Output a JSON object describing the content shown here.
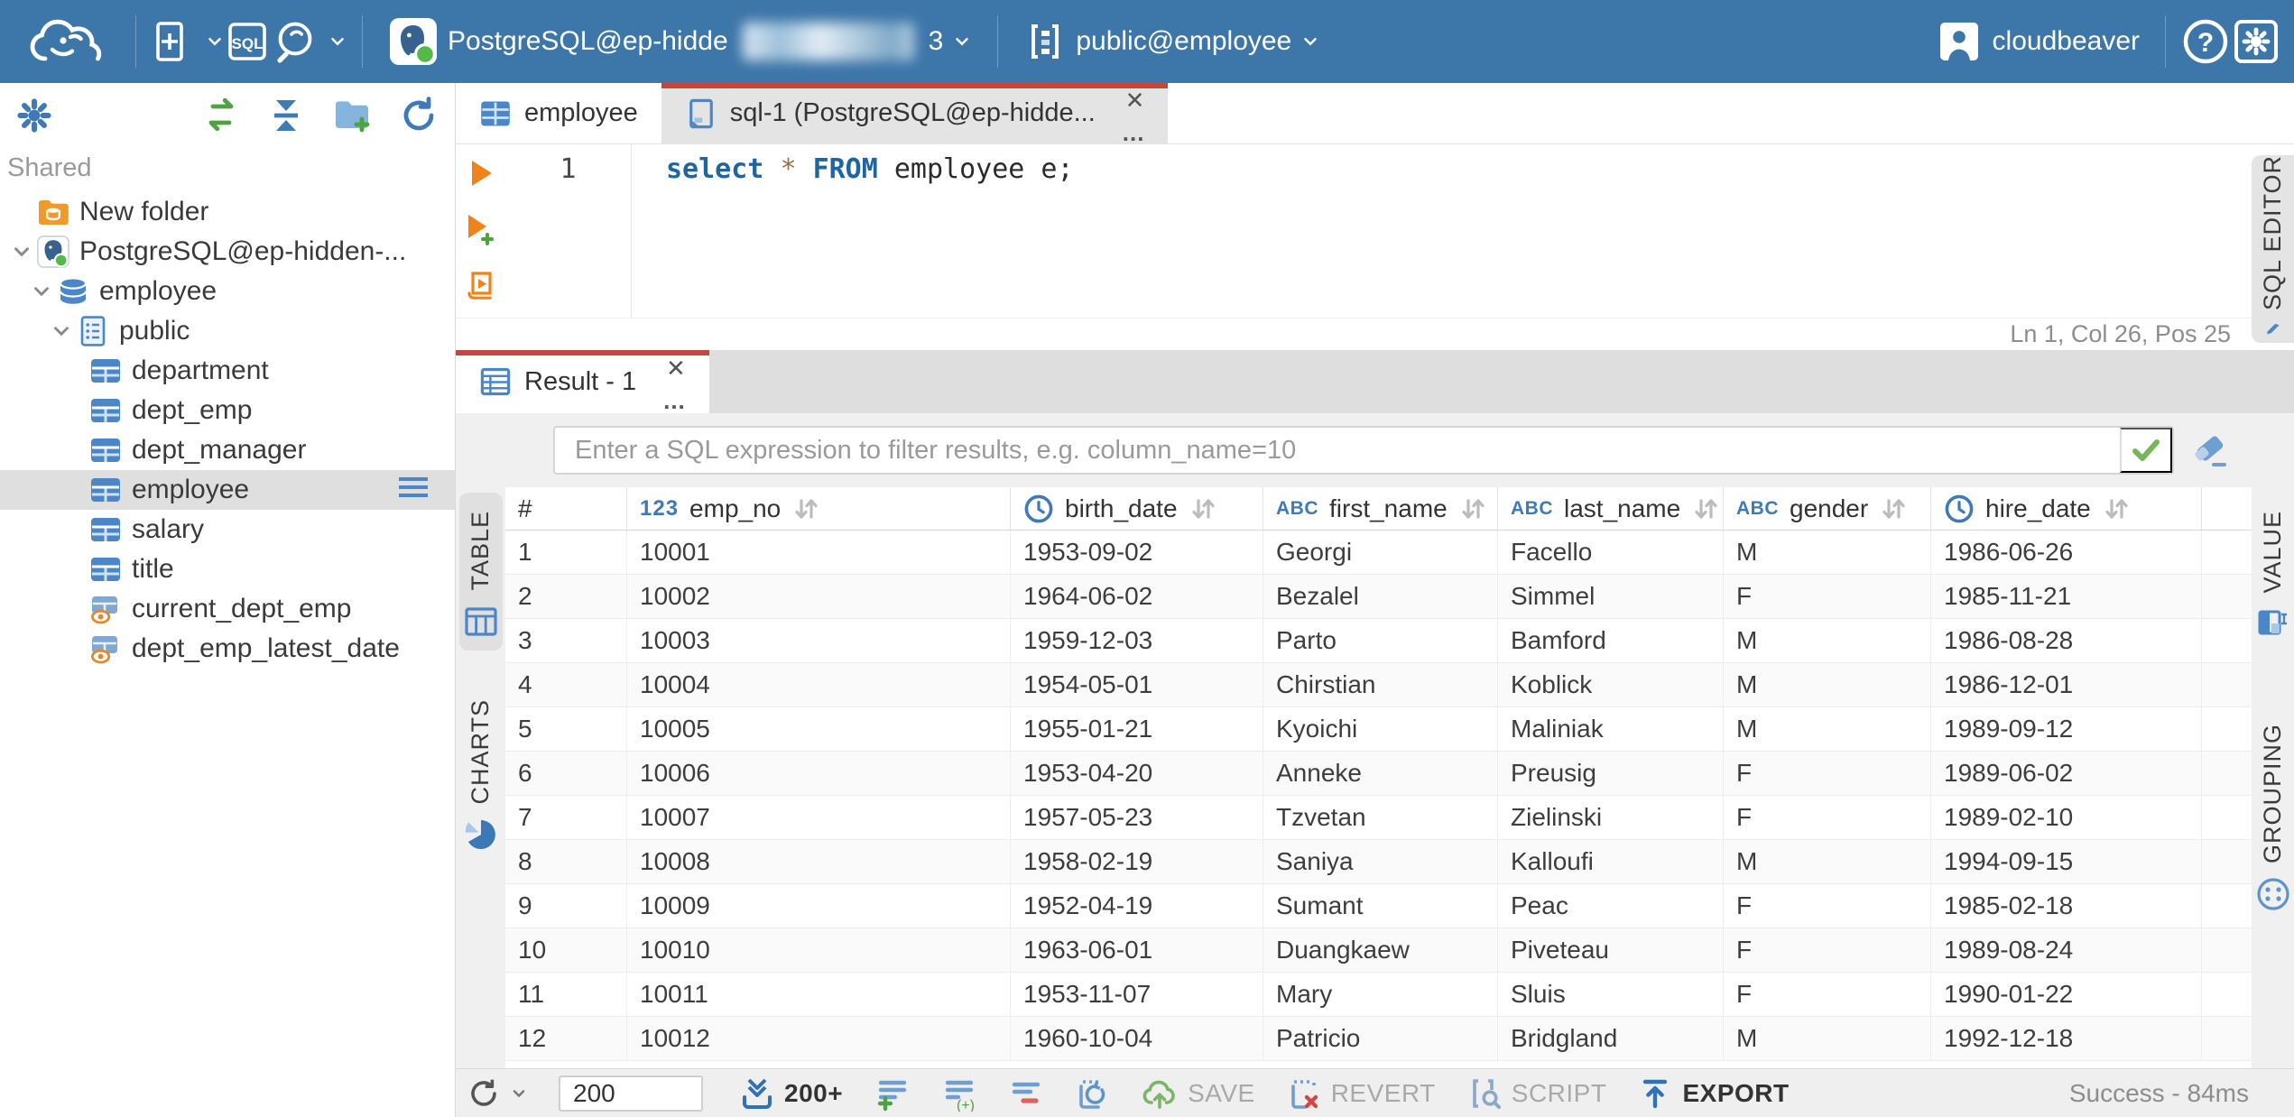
{
  "topbar": {
    "sql_badge": "SQL",
    "connection": {
      "label_visible": "PostgreSQL@ep-hidde",
      "label_suffix": "3",
      "redacted": true
    },
    "schema": "public@employee",
    "user": "cloudbeaver"
  },
  "sidebar": {
    "section_label": "Shared",
    "tree": [
      {
        "label": "New folder",
        "icon": "folder-db",
        "level": 1,
        "chevron": false
      },
      {
        "label": "PostgreSQL@ep-hidden-...",
        "icon": "postgres",
        "level": 1,
        "chevron": true
      },
      {
        "label": "employee",
        "icon": "database",
        "level": 2,
        "chevron": true
      },
      {
        "label": "public",
        "icon": "schema",
        "level": 3,
        "chevron": true
      },
      {
        "label": "department",
        "icon": "table",
        "level": 4,
        "chevron": false
      },
      {
        "label": "dept_emp",
        "icon": "table",
        "level": 4,
        "chevron": false
      },
      {
        "label": "dept_manager",
        "icon": "table",
        "level": 4,
        "chevron": false
      },
      {
        "label": "employee",
        "icon": "table",
        "level": 4,
        "chevron": false,
        "selected": true
      },
      {
        "label": "salary",
        "icon": "table",
        "level": 4,
        "chevron": false
      },
      {
        "label": "title",
        "icon": "table",
        "level": 4,
        "chevron": false
      },
      {
        "label": "current_dept_emp",
        "icon": "view",
        "level": 4,
        "chevron": false
      },
      {
        "label": "dept_emp_latest_date",
        "icon": "view",
        "level": 4,
        "chevron": false
      }
    ]
  },
  "tabs": [
    {
      "label": "employee",
      "active": false
    },
    {
      "label": "sql-1 (PostgreSQL@ep-hidde...",
      "active": true
    }
  ],
  "editor": {
    "line_number": "1",
    "sql": "select * FROM employee e;",
    "tokens": [
      {
        "text": "select",
        "style": "kw"
      },
      {
        "text": " ",
        "style": ""
      },
      {
        "text": "*",
        "style": "star"
      },
      {
        "text": " ",
        "style": ""
      },
      {
        "text": "FROM",
        "style": "kw"
      },
      {
        "text": " employee e;",
        "style": ""
      }
    ],
    "status": "Ln 1, Col 26, Pos 25",
    "panel_tab": "SQL EDITOR"
  },
  "result": {
    "tab_label": "Result - 1",
    "filter_placeholder": "Enter a SQL expression to filter results, e.g. column_name=10",
    "side_tabs_left": [
      {
        "label": "TABLE",
        "icon": "grid-icon",
        "active": true
      },
      {
        "label": "CHARTS",
        "icon": "pie-icon",
        "active": false
      }
    ],
    "side_tabs_right": [
      {
        "label": "VALUE",
        "icon": "value-icon",
        "active": false
      },
      {
        "label": "GROUPING",
        "icon": "grouping-icon",
        "active": false
      }
    ],
    "grid": {
      "columns": [
        {
          "label": "#",
          "type": "",
          "sortable": false
        },
        {
          "label": "emp_no",
          "type": "123",
          "sortable": true
        },
        {
          "label": "birth_date",
          "type": "clock",
          "sortable": true
        },
        {
          "label": "first_name",
          "type": "abc",
          "sortable": true
        },
        {
          "label": "last_name",
          "type": "abc",
          "sortable": true
        },
        {
          "label": "gender",
          "type": "abc",
          "sortable": true
        },
        {
          "label": "hire_date",
          "type": "clock",
          "sortable": true
        }
      ],
      "rows": [
        [
          "1",
          "10001",
          "1953-09-02",
          "Georgi",
          "Facello",
          "M",
          "1986-06-26"
        ],
        [
          "2",
          "10002",
          "1964-06-02",
          "Bezalel",
          "Simmel",
          "F",
          "1985-11-21"
        ],
        [
          "3",
          "10003",
          "1959-12-03",
          "Parto",
          "Bamford",
          "M",
          "1986-08-28"
        ],
        [
          "4",
          "10004",
          "1954-05-01",
          "Chirstian",
          "Koblick",
          "M",
          "1986-12-01"
        ],
        [
          "5",
          "10005",
          "1955-01-21",
          "Kyoichi",
          "Maliniak",
          "M",
          "1989-09-12"
        ],
        [
          "6",
          "10006",
          "1953-04-20",
          "Anneke",
          "Preusig",
          "F",
          "1989-06-02"
        ],
        [
          "7",
          "10007",
          "1957-05-23",
          "Tzvetan",
          "Zielinski",
          "F",
          "1989-02-10"
        ],
        [
          "8",
          "10008",
          "1958-02-19",
          "Saniya",
          "Kalloufi",
          "M",
          "1994-09-15"
        ],
        [
          "9",
          "10009",
          "1952-04-19",
          "Sumant",
          "Peac",
          "F",
          "1985-02-18"
        ],
        [
          "10",
          "10010",
          "1963-06-01",
          "Duangkaew",
          "Piveteau",
          "F",
          "1989-08-24"
        ],
        [
          "11",
          "10011",
          "1953-11-07",
          "Mary",
          "Sluis",
          "F",
          "1990-01-22"
        ],
        [
          "12",
          "10012",
          "1960-10-04",
          "Patricio",
          "Bridgland",
          "M",
          "1992-12-18"
        ]
      ]
    },
    "toolbar": {
      "row_limit_value": "200",
      "fetch_more": "200+",
      "save": "SAVE",
      "revert": "REVERT",
      "script": "SCRIPT",
      "export": "EXPORT",
      "status": "Success - 84ms"
    }
  },
  "colors": {
    "topbar": "#3d76a8",
    "accent_red": "#c4473d",
    "icon_blue": "#3f7ab8",
    "success_green": "#76b65a",
    "exec_orange": "#ef8318"
  }
}
